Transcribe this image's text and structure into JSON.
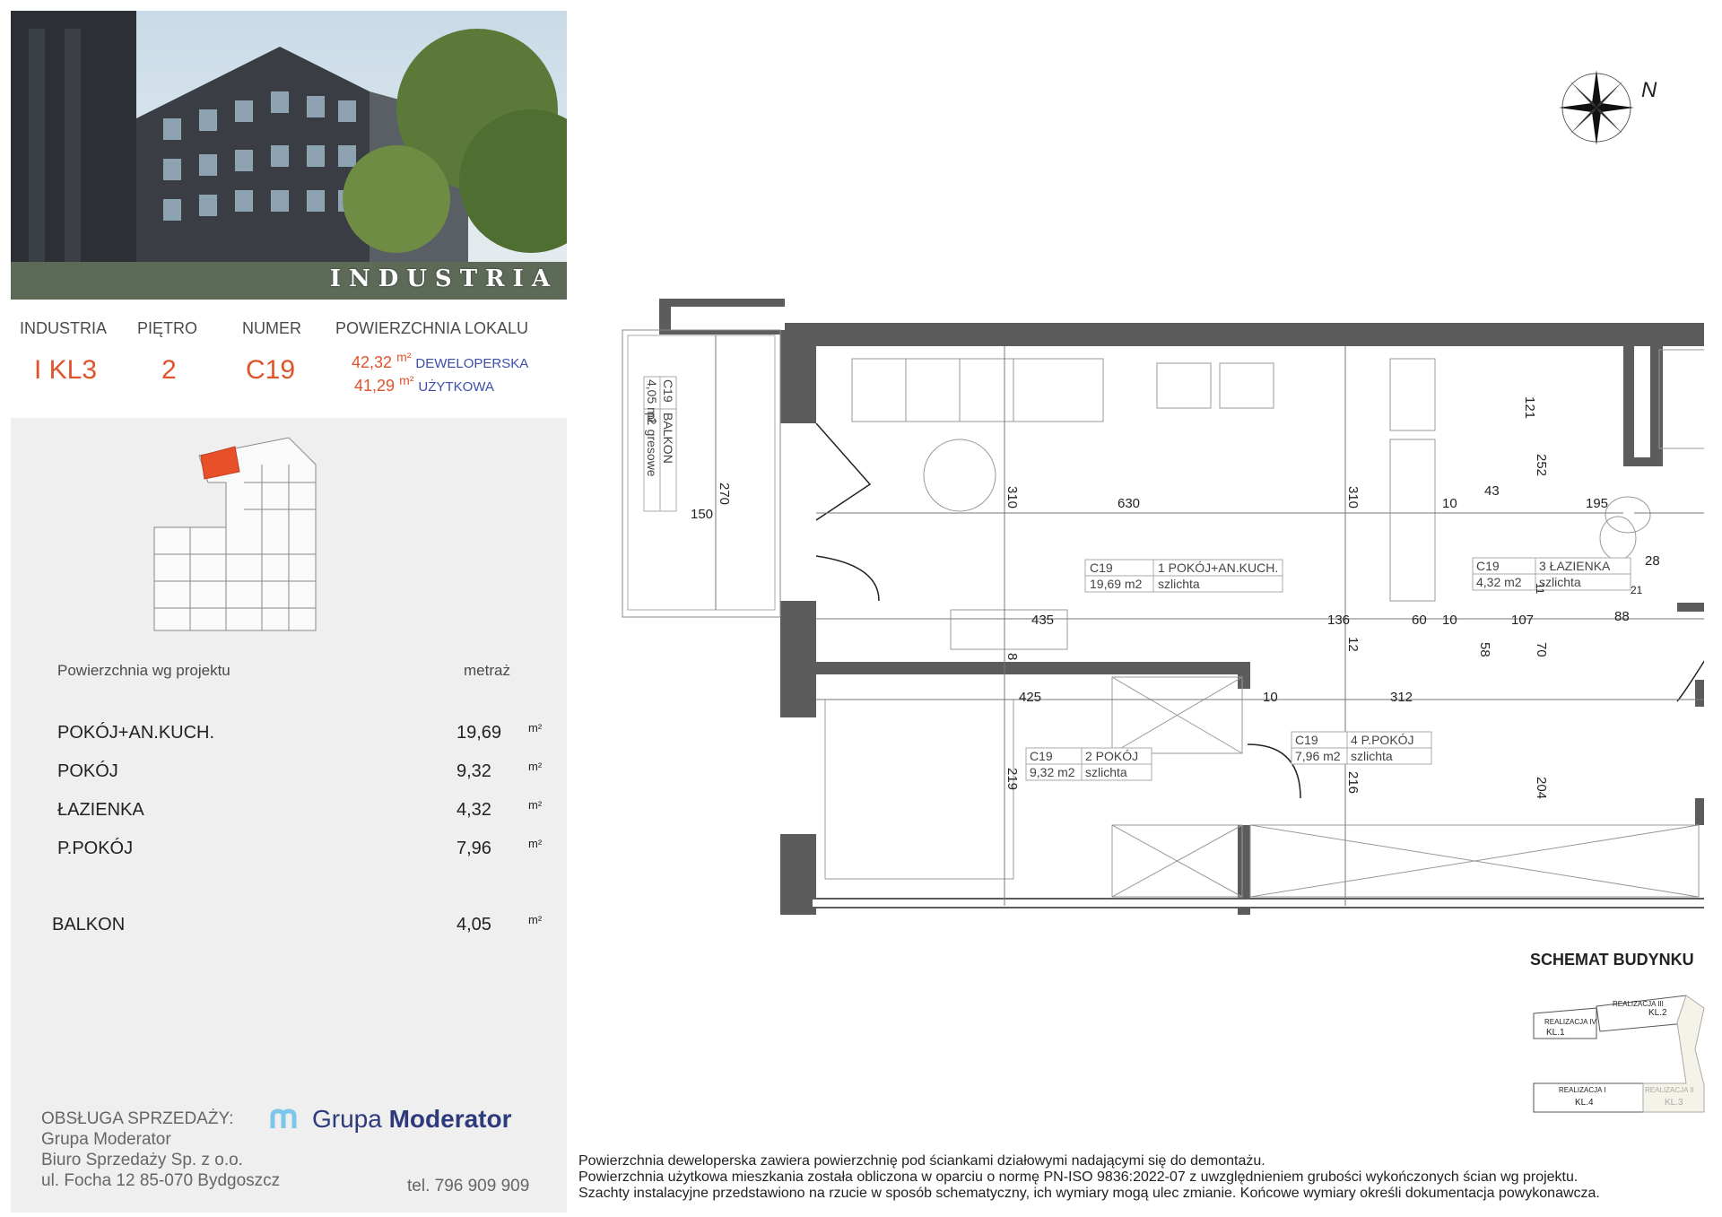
{
  "hero": {
    "brand": "INDUSTRIA"
  },
  "info": {
    "headers": {
      "project": "INDUSTRIA",
      "floor": "PIĘTRO",
      "number": "NUMER",
      "area": "POWIERZCHNIA LOKALU"
    },
    "values": {
      "project": "I KL3",
      "floor": "2",
      "number": "C19"
    },
    "areas": [
      {
        "value": "42,32",
        "unit": "m²",
        "label": "DEWELOPERSKA"
      },
      {
        "value": "41,29",
        "unit": "m²",
        "label": "UŻYTKOWA"
      }
    ]
  },
  "table": {
    "header_left": "Powierzchnia wg projektu",
    "header_right": "metraż",
    "rows": [
      {
        "name": "POKÓJ+AN.KUCH.",
        "value": "19,69",
        "unit": "m²"
      },
      {
        "name": "POKÓJ",
        "value": "9,32",
        "unit": "m²"
      },
      {
        "name": "ŁAZIENKA",
        "value": "4,32",
        "unit": "m²"
      },
      {
        "name": "P.POKÓJ",
        "value": "7,96",
        "unit": "m²"
      },
      {
        "name": "BALKON",
        "value": "4,05",
        "unit": "m²"
      }
    ]
  },
  "sales": {
    "title": "OBSŁUGA SPRZEDAŻY:",
    "line1": "Grupa Moderator",
    "line2": "Biuro Sprzedaży Sp. z o.o.",
    "line3": "ul. Focha 12 85-070 Bydgoszcz",
    "phone": "tel. 796 909 909",
    "logo_word1": "Grupa",
    "logo_word2": "Moderator"
  },
  "compass": {
    "label": "N"
  },
  "rooms": [
    {
      "code": "C19",
      "name": "1 POKÓJ+AN.KUCH.",
      "area": "19,69 m2",
      "finish": "szlichta"
    },
    {
      "code": "C19",
      "name": "2 POKÓJ",
      "area": "9,32 m2",
      "finish": "szlichta"
    },
    {
      "code": "C19",
      "name": "3 ŁAZIENKA",
      "area": "4,32 m2",
      "finish": "szlichta"
    },
    {
      "code": "C19",
      "name": "4 P.POKÓJ",
      "area": "7,96 m2",
      "finish": "szlichta"
    },
    {
      "code": "C19",
      "name": "BALKON",
      "area": "4,05 m2",
      "finish": "pł. gresowe"
    }
  ],
  "dimensions": [
    "270",
    "150",
    "310",
    "630",
    "310",
    "10",
    "43",
    "195",
    "121",
    "252",
    "28",
    "21",
    "11",
    "88",
    "107",
    "70",
    "58",
    "60",
    "10",
    "136",
    "12",
    "435",
    "8",
    "425",
    "10",
    "312",
    "219",
    "216",
    "204"
  ],
  "schemat": {
    "title": "SCHEMAT BUDYNKU",
    "labels": [
      "REALIZACJA III",
      "KL.2",
      "REALIZACJA IV",
      "KL.1",
      "REALIZACJA I",
      "KL.4",
      "REALIZACJA II",
      "KL.3"
    ]
  },
  "notes": [
    "Powierzchnia deweloperska zawiera powierzchnię pod ściankami działowymi nadającymi się do demontażu.",
    "Powierzchnia użytkowa mieszkania została obliczona w oparciu o normę  PN-ISO 9836:2022-07 z uwzględnieniem grubości wykończonych ścian wg projektu.",
    "Szachty instalacyjne przedstawiono na rzucie w sposób schematyczny, ich wymiary mogą ulec zmianie. Końcowe wymiary określi dokumentacja powykonawcza."
  ],
  "colors": {
    "accent": "#e0532b",
    "blue": "#3a4fa8",
    "panel": "#efefef",
    "wall": "#5c5c5c"
  }
}
